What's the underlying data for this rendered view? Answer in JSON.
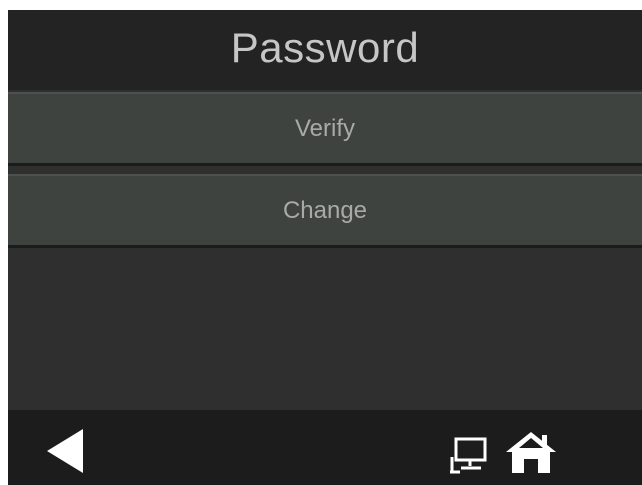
{
  "header": {
    "title": "Password"
  },
  "menu": {
    "items": [
      {
        "label": "Verify"
      },
      {
        "label": "Change"
      }
    ]
  },
  "footer": {
    "icons": [
      "back-arrow-icon",
      "network-icon",
      "home-icon"
    ]
  },
  "colors": {
    "screen_bg": "#2f2f2f",
    "title_bar_bg": "#232323",
    "menu_item_bg": "#3f4340",
    "bottom_bar_bg": "#1c1c1c",
    "title_text": "#c6c6c6",
    "menu_text": "#a8aaa9",
    "icon": "#ffffff"
  }
}
